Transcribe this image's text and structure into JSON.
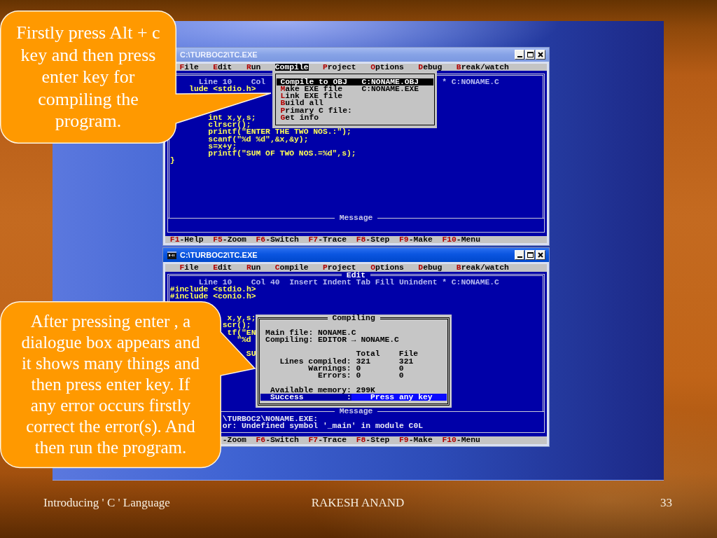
{
  "callouts": [
    {
      "text": "Firstly press Alt + c key and then press enter key for compiling the program."
    },
    {
      "text": "After pressing enter , a dialogue box appears and it shows many things and then press enter key. If any error occurs firstly correct the error(s). And then run the program."
    }
  ],
  "windows": [
    {
      "title": "C:\\TURBOC2\\TC.EXE",
      "active": false,
      "menu": [
        {
          "label": "File",
          "selected": false
        },
        {
          "label": "Edit",
          "selected": false
        },
        {
          "label": "Run",
          "selected": false
        },
        {
          "label": "Compile",
          "selected": true
        },
        {
          "label": "Project",
          "selected": false
        },
        {
          "label": "Options",
          "selected": false
        },
        {
          "label": "Debug",
          "selected": false
        },
        {
          "label": "Break/watch",
          "selected": false
        }
      ],
      "editor": {
        "position": "Line 10",
        "column": "Col",
        "file": "* C:NONAME.C",
        "code": [
          "lude <stdio.h>",
          "int x,y,s;",
          "clrscr();",
          "printf(\"ENTER THE TWO NOS.:\");",
          "scanf(\"%d %d\",&x,&y);",
          "s=x+y;",
          "printf(\"SUM OF TWO NOS.=%d\",s);",
          "}"
        ]
      },
      "message_title": "Message",
      "hotkeys": [
        {
          "key": "F1",
          "label": "-Help"
        },
        {
          "key": "F5",
          "label": "-Zoom"
        },
        {
          "key": "F6",
          "label": "-Switch"
        },
        {
          "key": "F7",
          "label": "-Trace"
        },
        {
          "key": "F8",
          "label": "-Step"
        },
        {
          "key": "F9",
          "label": "-Make"
        },
        {
          "key": "F10",
          "label": "-Menu"
        }
      ],
      "dropdown": [
        {
          "label": "Compile to OBJ",
          "value": "C:NONAME.OBJ",
          "selected": true
        },
        {
          "label": "Make EXE file",
          "value": "C:NONAME.EXE",
          "selected": false
        },
        {
          "label": "Link EXE file",
          "selected": false
        },
        {
          "label": "Build all",
          "selected": false
        },
        {
          "label": "Primary C file:",
          "selected": false
        },
        {
          "label": "Get info",
          "selected": false
        }
      ]
    },
    {
      "title": "C:\\TURBOC2\\TC.EXE",
      "active": true,
      "menu": [
        {
          "label": "File",
          "selected": false
        },
        {
          "label": "Edit",
          "selected": false
        },
        {
          "label": "Run",
          "selected": false
        },
        {
          "label": "Compile",
          "selected": false
        },
        {
          "label": "Project",
          "selected": false
        },
        {
          "label": "Options",
          "selected": false
        },
        {
          "label": "Debug",
          "selected": false
        },
        {
          "label": "Break/watch",
          "selected": false
        }
      ],
      "editor": {
        "title": "Edit",
        "position": "Line 10",
        "column": "Col 40",
        "modes": "Insert Indent Tab Fill Unindent",
        "file": "* C:NONAME.C",
        "code": [
          "#include <stdio.h>",
          "#include <conio.h>",
          "x,y,s;",
          "scr();",
          "tf(\"EN",
          "\"%d",
          "SU"
        ]
      },
      "message_title": "Message",
      "messages": [
        "\\TURBOC2\\NONAME.EXE:",
        "or: Undefined symbol '_main' in module C0L"
      ],
      "hotkeys": [
        {
          "label": "-Zoom"
        },
        {
          "key": "F6",
          "label": "-Switch"
        },
        {
          "key": "F7",
          "label": "-Trace"
        },
        {
          "key": "F8",
          "label": "-Step"
        },
        {
          "key": "F9",
          "label": "-Make"
        },
        {
          "key": "F10",
          "label": "-Menu"
        }
      ],
      "dialog": {
        "title": "Compiling",
        "lines": [
          "Main file: NONAME.C",
          "Compiling: EDITOR → NONAME.C"
        ],
        "columns": [
          "Total",
          "File"
        ],
        "rows": [
          {
            "label": "Lines compiled:",
            "total": "321",
            "file": "321"
          },
          {
            "label": "Warnings:",
            "total": "0",
            "file": "0"
          },
          {
            "label": "Errors:",
            "total": "0",
            "file": "0"
          }
        ],
        "memory": "Available memory: 299K",
        "result": {
          "status": "Success",
          "separator": ":",
          "prompt": "Press any key"
        }
      }
    }
  ],
  "footer": {
    "left": "Introducing ' C ' Language",
    "center": "RAKESH ANAND",
    "page": "33"
  }
}
